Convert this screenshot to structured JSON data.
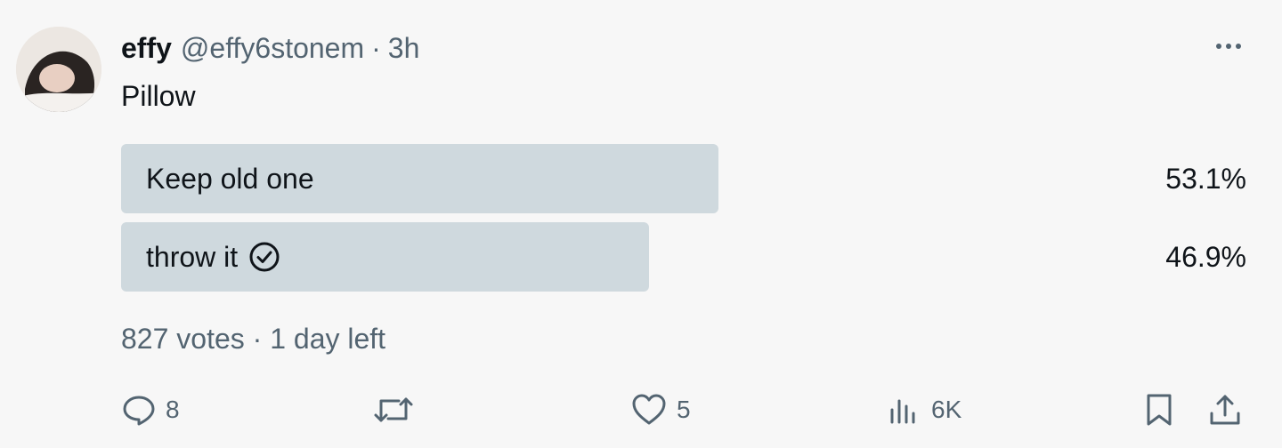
{
  "tweet": {
    "author": {
      "name": "effy",
      "handle": "@effy6stonem",
      "separator": "·",
      "time": "3h"
    },
    "text": "Pillow",
    "poll": {
      "options": [
        {
          "label": "Keep old one",
          "percent": "53.1%",
          "fraction": 0.531,
          "selected": false
        },
        {
          "label": "throw it",
          "percent": "46.9%",
          "fraction": 0.469,
          "selected": true
        }
      ],
      "meta": "827 votes · 1 day left"
    },
    "actions": {
      "replies": "8",
      "retweets": "",
      "likes": "5",
      "views": "6K"
    }
  },
  "colors": {
    "background": "#f7f7f7",
    "text_primary": "#0f1419",
    "text_secondary": "#536471",
    "poll_bar": "#cfd9de"
  },
  "icons": {
    "more": "more-horizontal-icon",
    "check": "check-circle-icon",
    "reply": "reply-icon",
    "retweet": "retweet-icon",
    "like": "heart-icon",
    "views": "views-icon",
    "bookmark": "bookmark-icon",
    "share": "share-icon"
  }
}
